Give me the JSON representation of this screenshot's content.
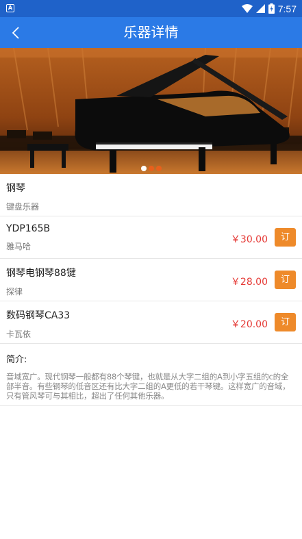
{
  "status_bar": {
    "app_icon_letter": "A",
    "time": "7:57",
    "battery_level": "battery-charging-icon"
  },
  "app_bar": {
    "title": "乐器详情",
    "back_icon": "back-chevron-icon"
  },
  "banner": {
    "image": "grand-piano-concert-hall",
    "slide_count": 3,
    "active_slide": 1
  },
  "instrument": {
    "name": "钢琴",
    "category": "键盘乐器"
  },
  "products": [
    {
      "model": "YDP165B",
      "brand": "雅马哈",
      "price": "￥30.00",
      "order_label": "订"
    },
    {
      "model": "钢琴电钢琴88键",
      "brand": "探律",
      "price": "￥28.00",
      "order_label": "订"
    },
    {
      "model": "数码钢琴CA33",
      "brand": "卡瓦依",
      "price": "￥20.00",
      "order_label": "订"
    }
  ],
  "intro": {
    "title": "简介:",
    "text": "音域宽广。现代钢琴一般都有88个琴键，也就是从大字二组的A到小字五组的c的全部半音。有些钢琴的低音区还有比大字二组的A更低的若干琴键。这样宽广的音域，只有管风琴可与其相比，超出了任何其他乐器。"
  },
  "colors": {
    "status_bar": "#1f62c9",
    "app_bar": "#2b7ae6",
    "price": "#e53935",
    "order_button": "#ee8a2a"
  }
}
